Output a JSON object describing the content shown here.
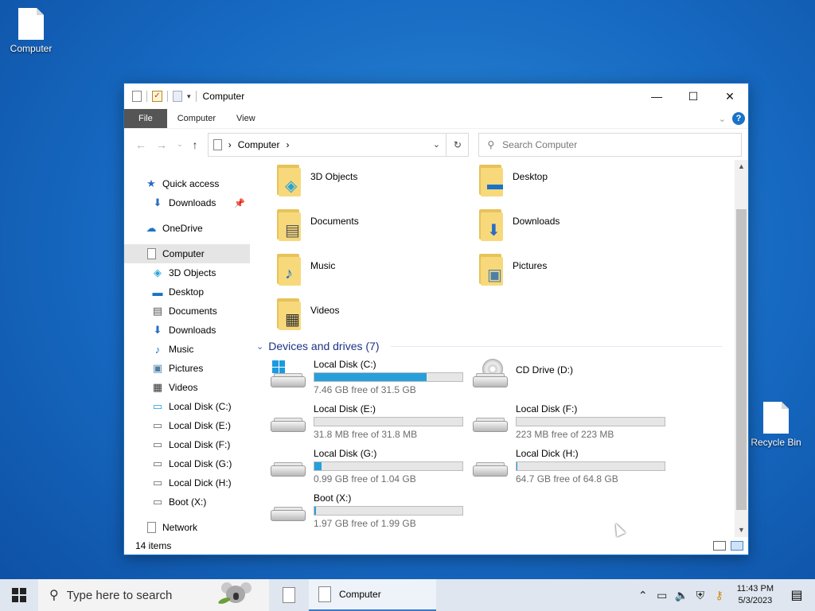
{
  "desktop": {
    "icons": [
      {
        "label": "Computer"
      },
      {
        "label": "Recycle Bin"
      }
    ]
  },
  "window": {
    "title": "Computer",
    "controls": {
      "minimize": "—",
      "maximize": "☐",
      "close": "✕"
    },
    "ribbon": {
      "file": "File",
      "tab1": "Computer",
      "tab2": "View",
      "help": "?"
    },
    "address": {
      "crumb": "Computer",
      "sep": "›"
    },
    "search": {
      "placeholder": "Search Computer"
    },
    "nav_pane": {
      "quick_access": "Quick access",
      "downloads_pinned": "Downloads",
      "onedrive": "OneDrive",
      "computer": "Computer",
      "children": [
        "3D Objects",
        "Desktop",
        "Documents",
        "Downloads",
        "Music",
        "Pictures",
        "Videos",
        "Local Disk (C:)",
        "Local Disk (E:)",
        "Local Disk (F:)",
        "Local Disk (G:)",
        "Local Dick (H:)",
        "Boot (X:)"
      ],
      "network": "Network"
    },
    "folders": [
      "3D Objects",
      "Desktop",
      "Documents",
      "Downloads",
      "Music",
      "Pictures",
      "Videos"
    ],
    "devices_header": "Devices and drives (7)",
    "drives": [
      {
        "name": "Local Disk (C:)",
        "free": "7.46 GB free of 31.5 GB",
        "used_fraction": 0.76,
        "type": "system"
      },
      {
        "name": "CD Drive (D:)",
        "free": "",
        "used_fraction": null,
        "type": "cd"
      },
      {
        "name": "Local Disk (E:)",
        "free": "31.8 MB free of 31.8 MB",
        "used_fraction": 0.0,
        "type": "disk"
      },
      {
        "name": "Local Disk (F:)",
        "free": "223 MB free of 223 MB",
        "used_fraction": 0.0,
        "type": "disk"
      },
      {
        "name": "Local Disk (G:)",
        "free": "0.99 GB free of 1.04 GB",
        "used_fraction": 0.05,
        "type": "disk"
      },
      {
        "name": "Local Dick (H:)",
        "free": "64.7 GB free of 64.8 GB",
        "used_fraction": 0.002,
        "type": "disk"
      },
      {
        "name": "Boot (X:)",
        "free": "1.97 GB free of 1.99 GB",
        "used_fraction": 0.01,
        "type": "disk"
      }
    ],
    "status": {
      "items": "14 items"
    }
  },
  "taskbar": {
    "search_placeholder": "Type here to search",
    "explorer_label": "Computer",
    "time": "11:43 PM",
    "date": "5/3/2023"
  },
  "colors": {
    "accent": "#1a73c8",
    "bar_fill": "#26a0da",
    "desktop": "#1668c0"
  }
}
